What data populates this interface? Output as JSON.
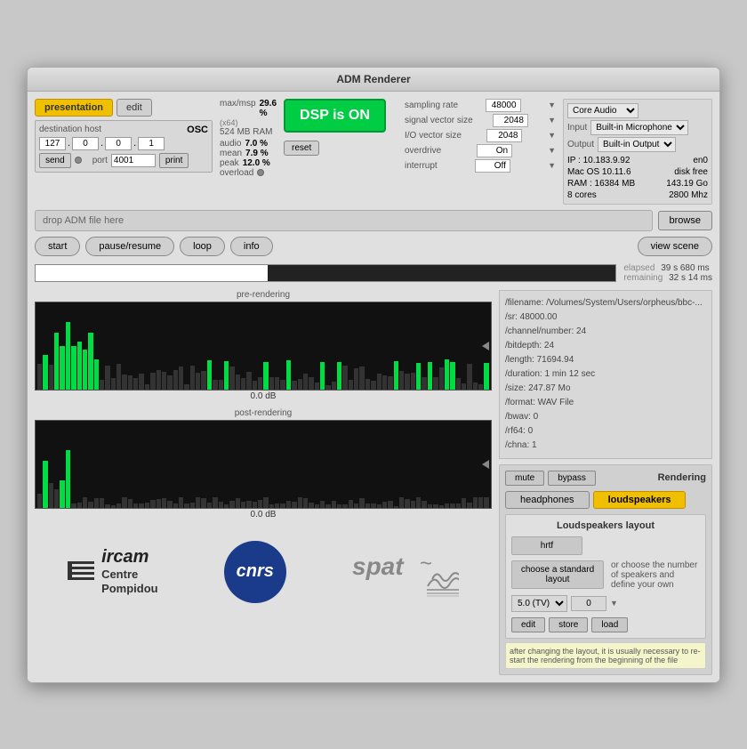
{
  "window": {
    "title": "ADM Renderer"
  },
  "tabs": {
    "presentation": "presentation",
    "edit": "edit"
  },
  "osc": {
    "label": "destination host",
    "title": "OSC",
    "host1": "127",
    "host2": "0",
    "host3": "0",
    "host4": "1",
    "port_label": "port",
    "port": "4001"
  },
  "buttons": {
    "send": "send",
    "print": "print",
    "browse": "browse",
    "start": "start",
    "pause_resume": "pause/resume",
    "loop": "loop",
    "info": "info",
    "view_scene": "view scene",
    "reset": "reset",
    "mute": "mute",
    "bypass": "bypass",
    "headphones": "headphones",
    "loudspeakers": "loudspeakers",
    "hrtf": "hrtf",
    "edit": "edit",
    "store": "store",
    "load": "load"
  },
  "stats": {
    "max_msp_label": "max/msp",
    "x64_label": "(x64)",
    "max_pct": "29.6 %",
    "ram": "524 MB RAM",
    "audio_label": "audio",
    "audio_val": "7.0 %",
    "mean_label": "mean",
    "mean_val": "7.9 %",
    "peak_label": "peak",
    "peak_val": "12.0 %",
    "overload_label": "overload"
  },
  "dsp": {
    "label": "DSP is ON"
  },
  "sampling": {
    "rate_label": "sampling rate",
    "rate_val": "48000",
    "signal_label": "signal vector size",
    "signal_val": "2048",
    "io_label": "I/O vector size",
    "io_val": "2048",
    "overdrive_label": "overdrive",
    "overdrive_val": "On",
    "interrupt_label": "interrupt",
    "interrupt_val": "Off"
  },
  "sys_info": {
    "audio": "Core Audio",
    "input_label": "Input",
    "input_val": "Built-in Microphone",
    "output_label": "Output",
    "output_val": "Built-in Output",
    "ip": "IP : 10.183.9.92",
    "interface": "en0",
    "os": "Mac OS 10.11.6",
    "disk": "disk free",
    "ram_label": "RAM : 16384 MB",
    "ram_size": "143.19 Go",
    "cores": "8 cores",
    "mhz": "2800 Mhz"
  },
  "file": {
    "drop_label": "drop ADM file here"
  },
  "progress": {
    "elapsed_label": "elapsed",
    "elapsed_val": "39 s 680 ms",
    "remaining_label": "remaining",
    "remaining_val": "32 s 14 ms"
  },
  "pre_rendering": {
    "title": "pre-rendering",
    "db_label": "0.0 dB"
  },
  "post_rendering": {
    "title": "post-rendering",
    "db_label": "0.0 dB"
  },
  "adm_info": {
    "filename": "/filename: /Volumes/System/Users/orpheus/bbc-...",
    "sr": "/sr: 48000.00",
    "channel_number": "/channel/number: 24",
    "bitdepth": "/bitdepth: 24",
    "length": "/length: 71694.94",
    "duration": "/duration: 1 min 12 sec",
    "size": "/size: 247.87 Mo",
    "format": "/format: WAV File",
    "bwav": "/bwav: 0",
    "rf64": "/rf64: 0",
    "chna": "/chna: 1"
  },
  "rendering": {
    "title": "Rendering",
    "loudspeakers_layout_title": "Loudspeakers layout",
    "choose_label": "choose a standard layout",
    "or_text": "or choose the number of speakers and define your own",
    "layout_val": "5.0 (TV)",
    "num_val": "0",
    "note": "after changing the layout, it is usually necessary to re-start the rendering from the beginning of the file"
  },
  "logos": {
    "ircam_text": "ircam",
    "centre": "Centre",
    "pompidou": "Pompidou",
    "cnrs": "cnrs",
    "spat": "spat~"
  }
}
